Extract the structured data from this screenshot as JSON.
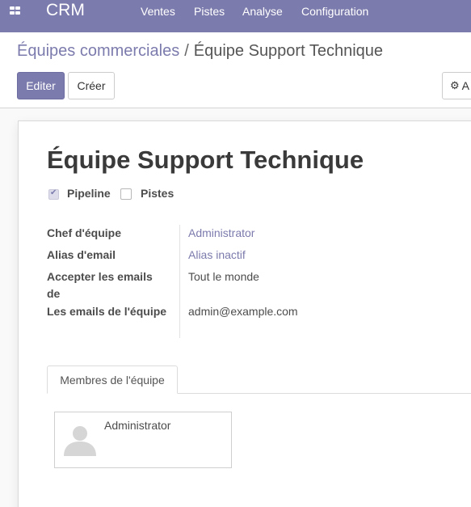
{
  "navbar": {
    "brand": "CRM",
    "menu": [
      "Ventes",
      "Pistes",
      "Analyse",
      "Configuration"
    ],
    "color": "#7c7bad"
  },
  "breadcrumb": {
    "parent": "Équipes commerciales",
    "separator": "/",
    "current": "Équipe Support Technique"
  },
  "buttons": {
    "edit": "Editer",
    "create": "Créer",
    "action": "A"
  },
  "record": {
    "title": "Équipe Support Technique",
    "options": [
      {
        "label": "Pipeline",
        "checked": true
      },
      {
        "label": "Pistes",
        "checked": false
      }
    ],
    "fields": [
      {
        "label": "Chef d'équipe",
        "value": "Administrator"
      },
      {
        "label": "Alias d'email",
        "value": "Alias inactif"
      },
      {
        "label": "Accepter les emails de",
        "value": "Tout le monde"
      },
      {
        "label": "Les emails de l'équipe",
        "value": "admin@example.com"
      }
    ]
  },
  "tabs": {
    "members": "Membres de l'équipe"
  },
  "members": [
    {
      "name": "Administrator",
      "avatar_icon": "user-placeholder-icon"
    }
  ]
}
